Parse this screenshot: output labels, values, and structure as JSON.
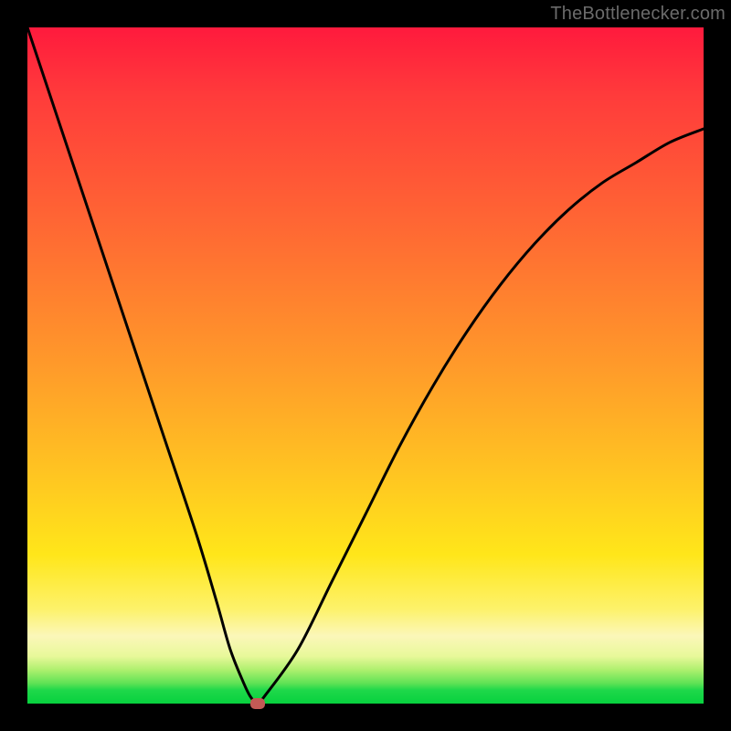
{
  "watermark": "TheBottlenecker.com",
  "colors": {
    "frame": "#000000",
    "curve": "#000000",
    "marker": "#c25a55"
  },
  "chart_data": {
    "type": "line",
    "title": "",
    "xlabel": "",
    "ylabel": "",
    "xlim": [
      0,
      100
    ],
    "ylim": [
      0,
      100
    ],
    "annotations": [
      "TheBottlenecker.com"
    ],
    "series": [
      {
        "name": "bottleneck-curve",
        "x": [
          0,
          5,
          10,
          15,
          20,
          25,
          28,
          30,
          32,
          33,
          34,
          35,
          40,
          45,
          50,
          55,
          60,
          65,
          70,
          75,
          80,
          85,
          90,
          95,
          100
        ],
        "y": [
          100,
          85,
          70,
          55,
          40,
          25,
          15,
          8,
          3,
          1,
          0,
          1,
          8,
          18,
          28,
          38,
          47,
          55,
          62,
          68,
          73,
          77,
          80,
          83,
          85
        ]
      }
    ],
    "marker": {
      "x": 34,
      "y": 0
    },
    "gradient_stops": [
      {
        "pos": 0,
        "color": "#ff1a3d"
      },
      {
        "pos": 50,
        "color": "#ff9a2a"
      },
      {
        "pos": 80,
        "color": "#ffe61a"
      },
      {
        "pos": 95,
        "color": "#aef06e"
      },
      {
        "pos": 100,
        "color": "#07d13e"
      }
    ]
  }
}
